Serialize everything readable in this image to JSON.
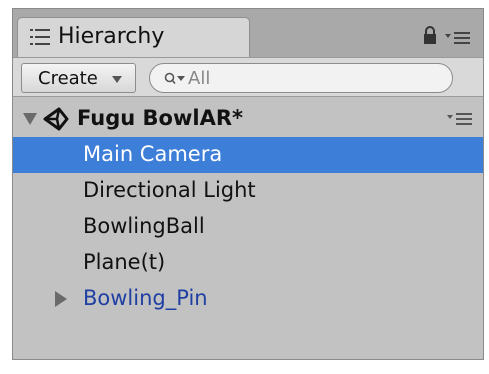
{
  "panel": {
    "tab_label": "Hierarchy",
    "tab_icon": "list-icon",
    "lock_icon": "lock-icon",
    "menu_icon": "options-menu-icon"
  },
  "toolbar": {
    "create_label": "Create",
    "search_placeholder": "All"
  },
  "scene": {
    "name": "Fugu BowlAR*",
    "expanded": true,
    "icon": "unity-logo-icon",
    "menu_icon": "options-menu-icon"
  },
  "objects": [
    {
      "name": "Main Camera",
      "selected": true
    },
    {
      "name": "Directional Light",
      "selected": false
    },
    {
      "name": "BowlingBall",
      "selected": false
    },
    {
      "name": "Plane(t)",
      "selected": false
    },
    {
      "name": "Bowling_Pin",
      "selected": false,
      "prefab": true,
      "collapsed": true
    }
  ],
  "colors": {
    "selection": "#3d7ed9",
    "prefab_text": "#1f3fa3",
    "panel_bg": "#c2c2c2"
  }
}
